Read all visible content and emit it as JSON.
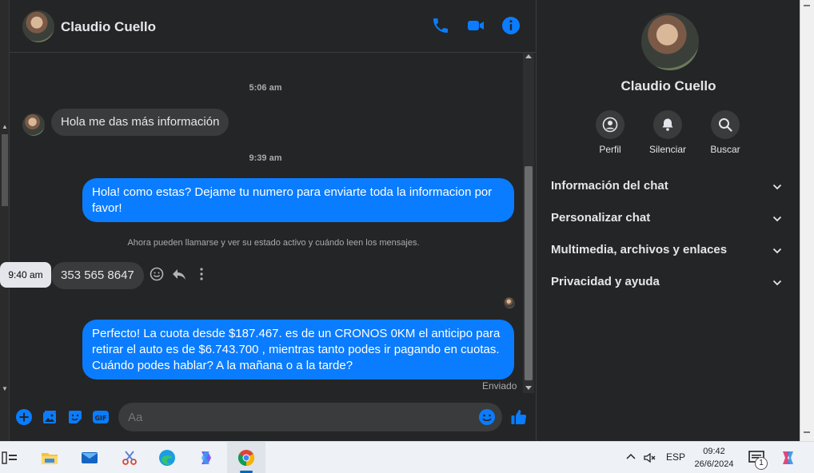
{
  "contact": {
    "name": "Claudio Cuello"
  },
  "messages": {
    "ts1": "5:06 am",
    "m1": "Hola me das más información",
    "ts2": "9:39 am",
    "m2": "Hola! como estas? Dejame tu numero para enviarte toda la informacion por favor!",
    "notice": "Ahora pueden llamarse y ver su estado activo y cuándo leen los mensajes.",
    "tooltip": "9:40 am",
    "m3": "353 565 8647",
    "m4": "Perfecto! La cuota desde $187.467. es de un CRONOS 0KM el anticipo para retirar el auto es de $6.743.700 , mientras tanto podes ir pagando en cuotas. Cuándo podes hablar? A la mañana o a la tarde?",
    "status": "Enviado"
  },
  "composer": {
    "placeholder": "Aa"
  },
  "info": {
    "actions": [
      "Perfil",
      "Silenciar",
      "Buscar"
    ],
    "sections": [
      "Información del chat",
      "Personalizar chat",
      "Multimedia, archivos y enlaces",
      "Privacidad y ayuda"
    ]
  },
  "taskbar": {
    "lang": "ESP",
    "time": "09:42",
    "date": "26/6/2024",
    "notif_count": "1"
  },
  "colors": {
    "accent": "#0a7cff",
    "bg": "#242526",
    "bubble_in": "#3a3b3c"
  }
}
